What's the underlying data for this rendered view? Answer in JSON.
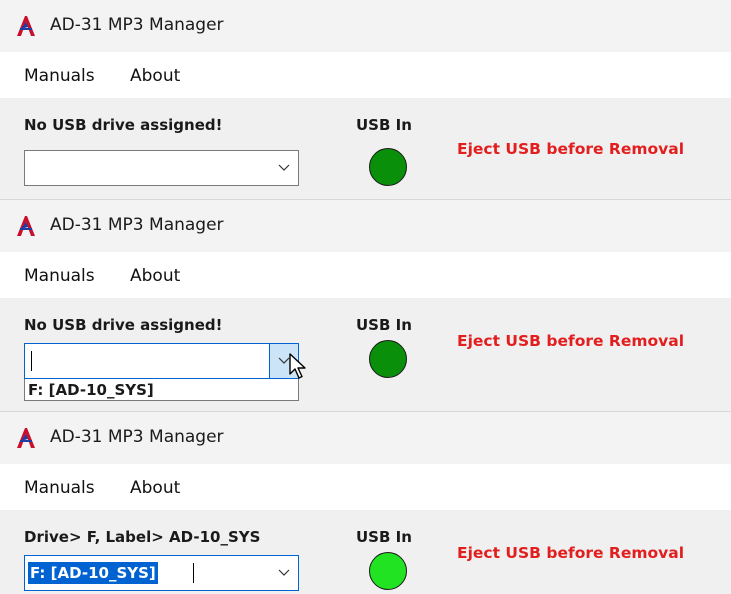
{
  "colors": {
    "eject_red": "#e21e1e",
    "led_off": "#0a8f0a",
    "led_on": "#22e322",
    "selection": "#0063d1",
    "titlebar_bg": "#f3f3f3",
    "client_bg": "#f0f0f0"
  },
  "icons": {
    "app": "ad-logo-icon",
    "dropdown": "chevron-down-icon",
    "cursor": "mouse-pointer-icon"
  },
  "windows": [
    {
      "title": "AD-31 MP3 Manager",
      "menu": [
        {
          "label": "Manuals"
        },
        {
          "label": "About"
        }
      ],
      "drive_label": "No USB drive assigned!",
      "usb_label": "USB In",
      "eject_label": "Eject USB before Removal",
      "combo_value": "",
      "led": "off"
    },
    {
      "title": "AD-31 MP3 Manager",
      "menu": [
        {
          "label": "Manuals"
        },
        {
          "label": "About"
        }
      ],
      "drive_label": "No USB drive assigned!",
      "usb_label": "USB In",
      "eject_label": "Eject USB before Removal",
      "combo_value": "",
      "dropdown_options": [
        "F: [AD-10_SYS]"
      ],
      "led": "off"
    },
    {
      "title": "AD-31 MP3 Manager",
      "menu": [
        {
          "label": "Manuals"
        },
        {
          "label": "About"
        }
      ],
      "drive_label": "Drive> F, Label> AD-10_SYS",
      "usb_label": "USB In",
      "eject_label": "Eject USB before Removal",
      "combo_value": "F: [AD-10_SYS]",
      "led": "on"
    }
  ]
}
